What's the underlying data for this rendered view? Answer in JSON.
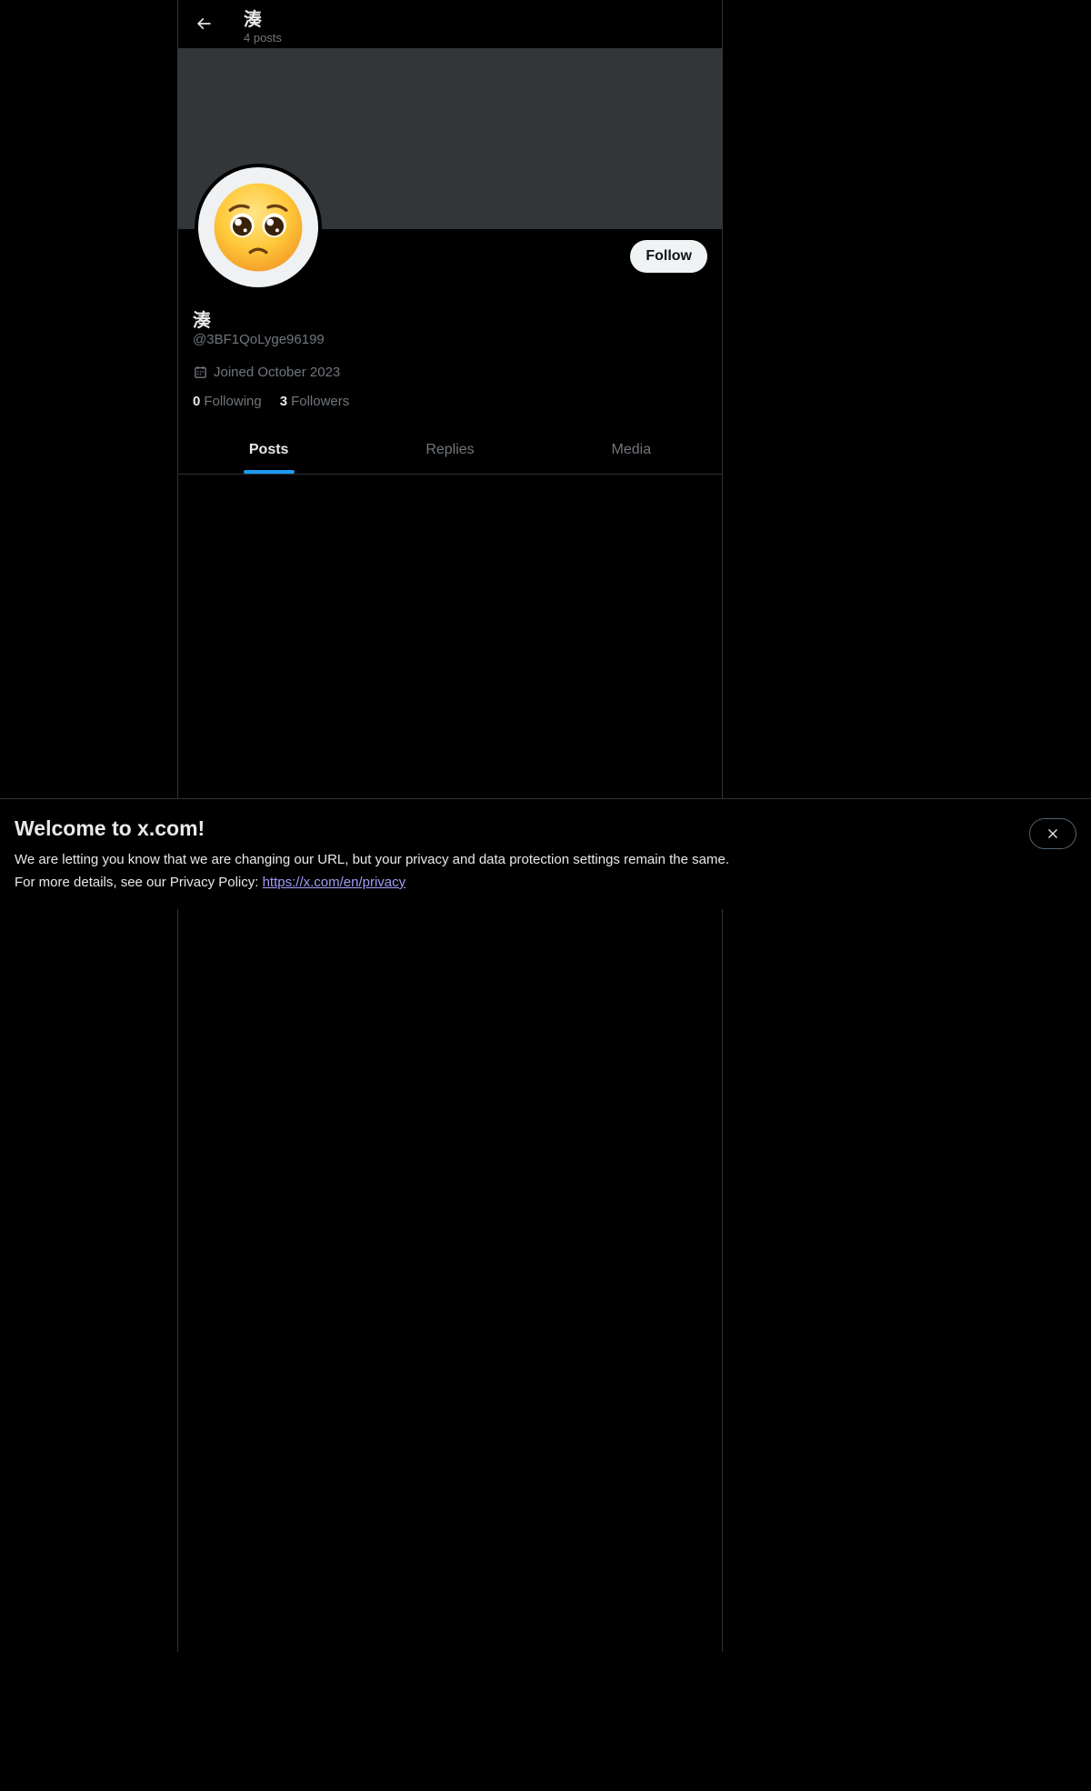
{
  "header": {
    "title": "湊",
    "post_count": "4 posts",
    "back_icon": "arrow-left-icon"
  },
  "profile": {
    "avatar_emoji": "🥺",
    "display_name": "湊",
    "handle": "@3BF1QoLyge96199",
    "joined": "Joined October 2023",
    "follow_label": "Follow",
    "following_count": "0",
    "following_label": "Following",
    "followers_count": "3",
    "followers_label": "Followers",
    "calendar_icon": "calendar-icon"
  },
  "tabs": [
    {
      "label": "Posts",
      "active": true
    },
    {
      "label": "Replies",
      "active": false
    },
    {
      "label": "Media",
      "active": false
    }
  ],
  "notice": {
    "title": "Welcome to x.com!",
    "line1": "We are letting you know that we are changing our URL, but your privacy and data protection settings remain the same.",
    "line2_prefix": "For more details, see our Privacy Policy: ",
    "link": "https://x.com/en/privacy",
    "close_icon": "close-icon"
  },
  "colors": {
    "background": "#000000",
    "banner": "#333639",
    "accent": "#1d9bf0",
    "muted_text": "#71767b",
    "link": "#a39cf4"
  }
}
